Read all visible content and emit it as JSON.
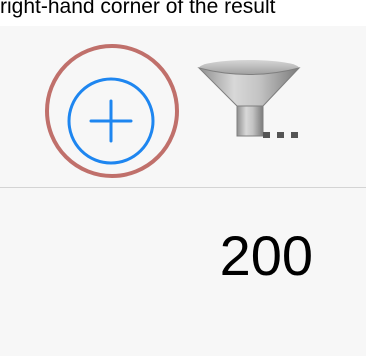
{
  "caption": {
    "text": "right-hand corner of the result"
  },
  "toolbar": {
    "add_button_icon": "plus-circle-icon",
    "add_button_highlight_color": "#c0706b",
    "accent_color": "#1e86f0",
    "filter_button_icon": "funnel-icon",
    "filter_more_icon": "ellipsis-icon"
  },
  "content": {
    "value": "200"
  }
}
